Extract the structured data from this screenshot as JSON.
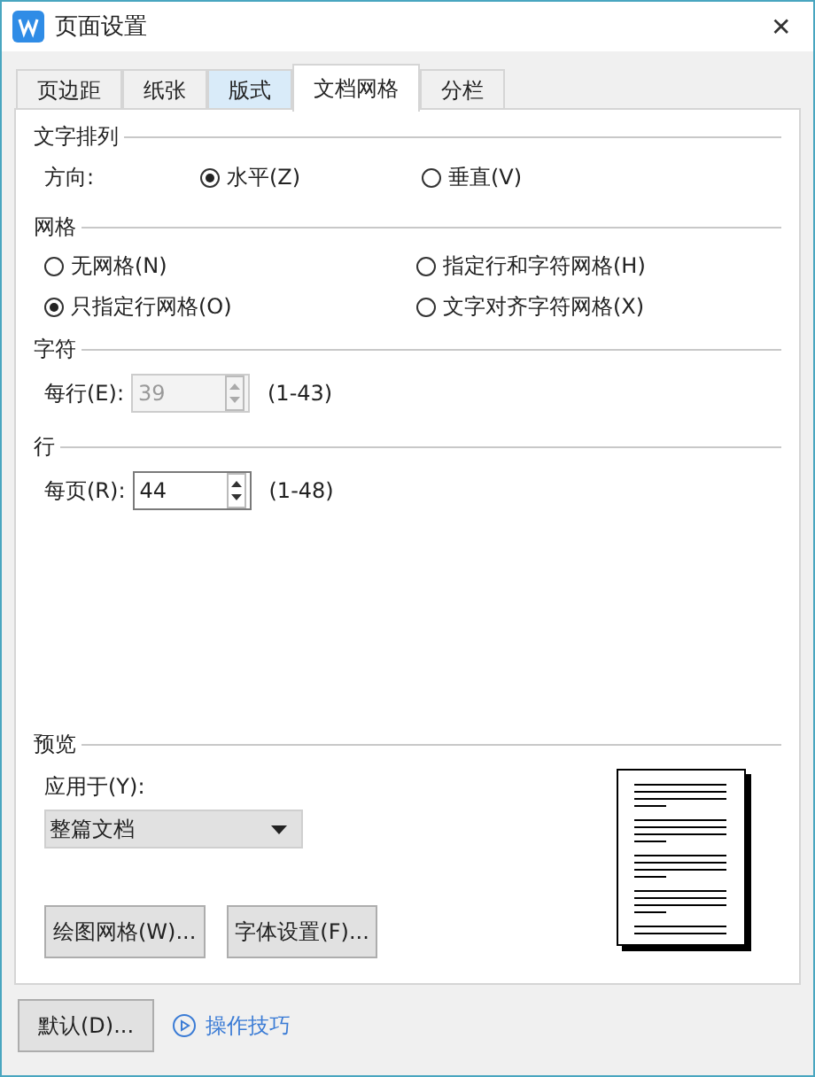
{
  "window": {
    "title": "页面设置",
    "close": "✕"
  },
  "tabs": [
    {
      "label": "页边距",
      "selected": false,
      "hovered": false
    },
    {
      "label": "纸张",
      "selected": false,
      "hovered": false
    },
    {
      "label": "版式",
      "selected": false,
      "hovered": true
    },
    {
      "label": "文档网格",
      "selected": true,
      "hovered": false
    },
    {
      "label": "分栏",
      "selected": false,
      "hovered": false
    }
  ],
  "text_direction": {
    "title": "文字排列",
    "label": "方向:",
    "options": [
      {
        "label": "水平(Z)",
        "selected": true
      },
      {
        "label": "垂直(V)",
        "selected": false
      }
    ]
  },
  "grid": {
    "title": "网格",
    "options": [
      {
        "label": "无网格(N)",
        "selected": false
      },
      {
        "label": "指定行和字符网格(H)",
        "selected": false
      },
      {
        "label": "只指定行网格(O)",
        "selected": true
      },
      {
        "label": "文字对齐字符网格(X)",
        "selected": false
      }
    ]
  },
  "characters": {
    "title": "字符",
    "label": "每行(E):",
    "value": "39",
    "range": "(1-43)",
    "disabled": true
  },
  "lines": {
    "title": "行",
    "label": "每页(R):",
    "value": "44",
    "range": "(1-48)",
    "disabled": false
  },
  "preview": {
    "title": "预览",
    "apply_label": "应用于(Y):",
    "apply_value": "整篇文档",
    "buttons": [
      "绘图网格(W)...",
      "字体设置(F)..."
    ]
  },
  "footer": {
    "default_button": "默认(D)...",
    "tips_link": "操作技巧"
  }
}
